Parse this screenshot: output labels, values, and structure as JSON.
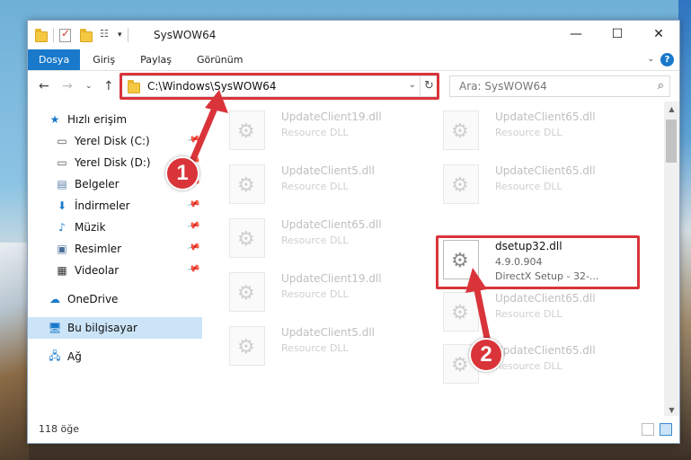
{
  "window": {
    "title": "SysWOW64",
    "controls": {
      "minimize": "—",
      "maximize": "☐",
      "close": "✕"
    }
  },
  "ribbon": {
    "tabs": [
      "Dosya",
      "Giriş",
      "Paylaş",
      "Görünüm"
    ],
    "help": "?"
  },
  "nav": {
    "address": "C:\\Windows\\SysWOW64",
    "search_placeholder": "Ara: SysWOW64"
  },
  "sidebar": {
    "items": [
      {
        "label": "Hızlı erişim",
        "icon": "star-icon"
      },
      {
        "label": "Yerel Disk (C:)",
        "icon": "drive-icon"
      },
      {
        "label": "Yerel Disk (D:)",
        "icon": "drive-icon"
      },
      {
        "label": "Belgeler",
        "icon": "documents-icon"
      },
      {
        "label": "İndirmeler",
        "icon": "download-icon"
      },
      {
        "label": "Müzik",
        "icon": "music-icon"
      },
      {
        "label": "Resimler",
        "icon": "pictures-icon"
      },
      {
        "label": "Videolar",
        "icon": "video-icon"
      },
      {
        "label": "OneDrive",
        "icon": "cloud-icon"
      },
      {
        "label": "Bu bilgisayar",
        "icon": "computer-icon"
      },
      {
        "label": "Ağ",
        "icon": "network-icon"
      }
    ]
  },
  "files": [
    {
      "name": "UpdateClient19.dll",
      "type": "Resource DLL"
    },
    {
      "name": "UpdateClient65.dll",
      "type": "Resource DLL"
    },
    {
      "name": "UpdateClient5.dll",
      "type": "Resource DLL"
    },
    {
      "name": "UpdateClient65.dll",
      "type": "Resource DLL"
    },
    {
      "name": "UpdateClient65.dll",
      "type": "Resource DLL"
    },
    {
      "name": "dsetup32.dll",
      "version": "4.9.0.904",
      "description": "DirectX Setup - 32-..."
    },
    {
      "name": "UpdateClient19.dll",
      "type": "Resource DLL"
    },
    {
      "name": "UpdateClient65.dll",
      "type": "Resource DLL"
    },
    {
      "name": "UpdateClient5.dll",
      "type": "Resource DLL"
    },
    {
      "name": "UpdateClient65.dll",
      "type": "Resource DLL"
    }
  ],
  "status": {
    "count": "118 öğe"
  },
  "callouts": {
    "one": "1",
    "two": "2"
  },
  "colors": {
    "accent": "#1979ca",
    "highlight": "#d9343a",
    "selected": "#cce4f7"
  }
}
